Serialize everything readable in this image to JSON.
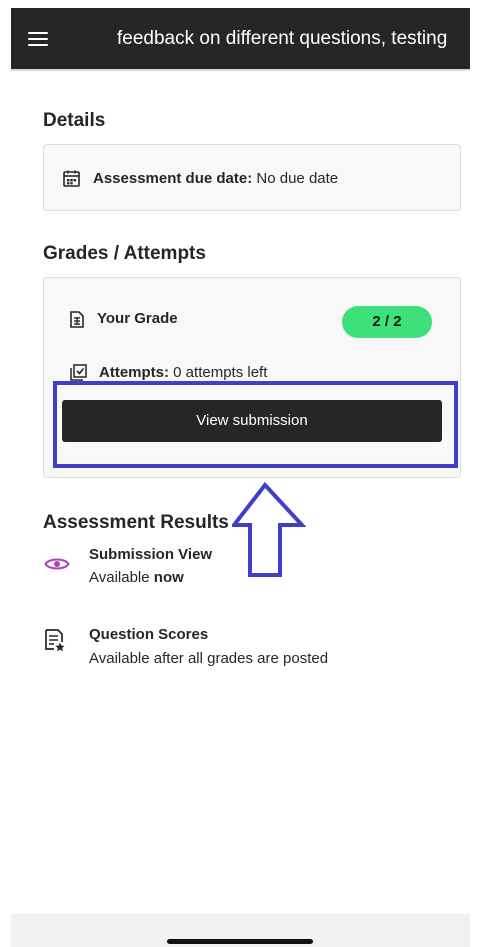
{
  "header": {
    "title": "feedback on different questions, testing",
    "menu_icon": "hamburger-menu-icon"
  },
  "details": {
    "section_title": "Details",
    "due_date_label": "Assessment due date:",
    "due_date_value": "No due date",
    "icon": "calendar-icon"
  },
  "grades": {
    "section_title": "Grades / Attempts",
    "your_grade_label": "Your Grade",
    "grade_value": "2 / 2",
    "attempts_label": "Attempts:",
    "attempts_value": "0 attempts left",
    "view_submission_label": "View submission",
    "grade_icon": "grade-document-icon",
    "attempts_icon": "attempts-checkbox-icon"
  },
  "results": {
    "section_title": "Assessment Results",
    "items": [
      {
        "title": "Submission View",
        "line_prefix": "Available",
        "line_bold": "now",
        "icon": "eye-icon"
      },
      {
        "title": "Question Scores",
        "line": "Available after all grades are posted",
        "icon": "question-scores-icon"
      }
    ]
  },
  "colors": {
    "header_bg": "#262626",
    "badge_green": "#3ee07b",
    "button_bg": "#262626",
    "highlight_blue": "#3f3fc8",
    "eye_purple": "#b23fc0"
  }
}
